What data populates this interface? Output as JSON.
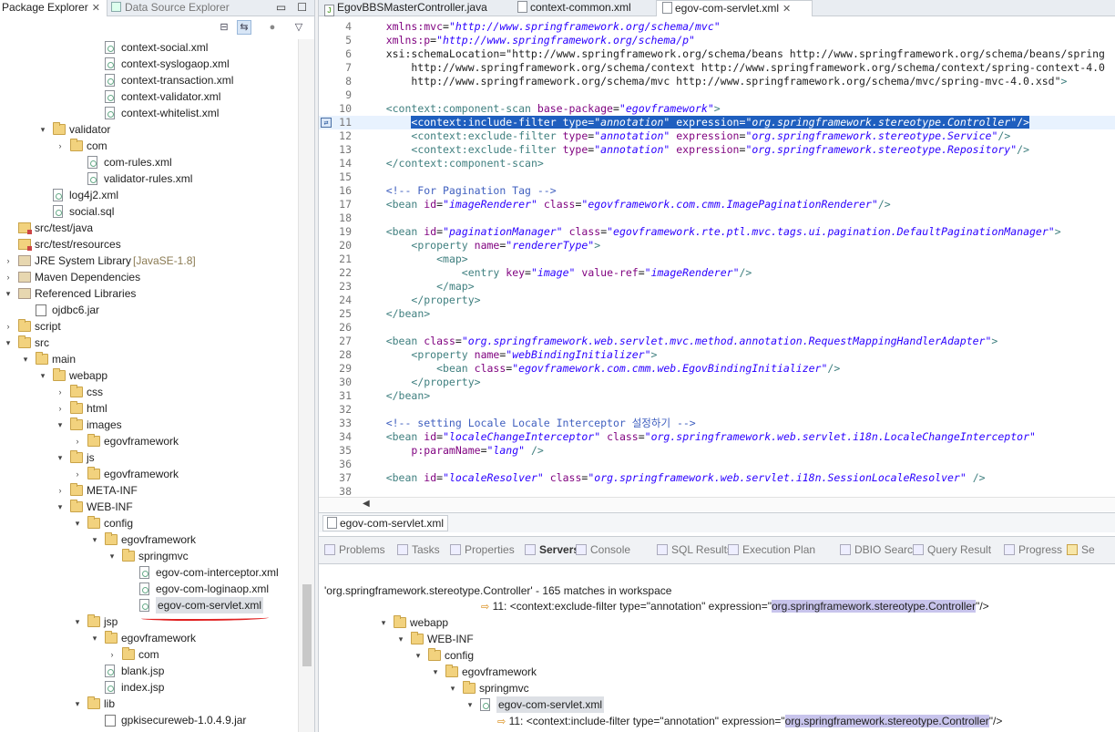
{
  "left_panel": {
    "tabs": [
      "Package Explorer",
      "Data Source Explorer"
    ],
    "window_buttons": [
      "▭",
      "☐"
    ],
    "toolbar_icons": [
      "collapse-all-icon",
      "link-with-editor-icon",
      "view-menu-icon",
      "dropdown-icon"
    ],
    "tree": [
      {
        "label": "context-social.xml",
        "icon": "xml-file-icon"
      },
      {
        "label": "context-syslogaop.xml",
        "icon": "xml-file-icon"
      },
      {
        "label": "context-transaction.xml",
        "icon": "xml-file-icon"
      },
      {
        "label": "context-validator.xml",
        "icon": "xml-file-icon"
      },
      {
        "label": "context-whitelist.xml",
        "icon": "xml-file-icon"
      },
      {
        "label": "validator",
        "icon": "folder-icon"
      },
      {
        "label": "com",
        "icon": "folder-icon"
      },
      {
        "label": "com-rules.xml",
        "icon": "xml-file-icon"
      },
      {
        "label": "validator-rules.xml",
        "icon": "xml-file-icon"
      },
      {
        "label": "log4j2.xml",
        "icon": "xml-file-icon"
      },
      {
        "label": "social.sql",
        "icon": "sql-file-icon"
      },
      {
        "label": "src/test/java",
        "icon": "source-folder-icon"
      },
      {
        "label": "src/test/resources",
        "icon": "source-folder-icon"
      },
      {
        "label": "JRE System Library",
        "suffix": "[JavaSE-1.8]",
        "icon": "library-icon"
      },
      {
        "label": "Maven Dependencies",
        "icon": "library-icon"
      },
      {
        "label": "Referenced Libraries",
        "icon": "library-icon"
      },
      {
        "label": "ojdbc6.jar",
        "icon": "jar-icon"
      },
      {
        "label": "script",
        "icon": "folder-icon"
      },
      {
        "label": "src",
        "icon": "folder-icon"
      },
      {
        "label": "main",
        "icon": "folder-icon"
      },
      {
        "label": "webapp",
        "icon": "folder-icon"
      },
      {
        "label": "css",
        "icon": "folder-icon"
      },
      {
        "label": "html",
        "icon": "folder-icon"
      },
      {
        "label": "images",
        "icon": "folder-icon"
      },
      {
        "label": "egovframework",
        "icon": "folder-icon"
      },
      {
        "label": "js",
        "icon": "folder-icon"
      },
      {
        "label": "egovframework",
        "icon": "folder-icon"
      },
      {
        "label": "META-INF",
        "icon": "folder-icon"
      },
      {
        "label": "WEB-INF",
        "icon": "folder-icon"
      },
      {
        "label": "config",
        "icon": "folder-icon"
      },
      {
        "label": "egovframework",
        "icon": "folder-icon"
      },
      {
        "label": "springmvc",
        "icon": "folder-icon"
      },
      {
        "label": "egov-com-interceptor.xml",
        "icon": "xml-file-icon"
      },
      {
        "label": "egov-com-loginaop.xml",
        "icon": "xml-file-icon"
      },
      {
        "label": "egov-com-servlet.xml",
        "icon": "xml-file-icon",
        "selected": true
      },
      {
        "label": "jsp",
        "icon": "folder-icon"
      },
      {
        "label": "egovframework",
        "icon": "folder-icon"
      },
      {
        "label": "com",
        "icon": "folder-icon"
      },
      {
        "label": "blank.jsp",
        "icon": "jsp-file-icon"
      },
      {
        "label": "index.jsp",
        "icon": "jsp-file-icon"
      },
      {
        "label": "lib",
        "icon": "folder-icon"
      },
      {
        "label": "gpkisecureweb-1.0.4.9.jar",
        "icon": "jar-icon"
      }
    ]
  },
  "editor": {
    "tabs": [
      "EgovBBSMasterController.java",
      "context-common.xml",
      "egov-com-servlet.xml"
    ],
    "active_tab": "egov-com-servlet.xml",
    "bottom_tab": "egov-com-servlet.xml",
    "lines": [
      {
        "n": "4",
        "t": "    xmlns:mvc=\"http://www.springframework.org/schema/mvc\""
      },
      {
        "n": "5",
        "t": "    xmlns:p=\"http://www.springframework.org/schema/p\""
      },
      {
        "n": "6",
        "t": "    xsi:schemaLocation=\"http://www.springframework.org/schema/beans http://www.springframework.org/schema/beans/spring"
      },
      {
        "n": "7",
        "t": "        http://www.springframework.org/schema/context http://www.springframework.org/schema/context/spring-context-4.0"
      },
      {
        "n": "8",
        "t": "        http://www.springframework.org/schema/mvc http://www.springframework.org/schema/mvc/spring-mvc-4.0.xsd\">"
      },
      {
        "n": "9",
        "t": ""
      },
      {
        "n": "10",
        "t": "    <context:component-scan base-package=\"egovframework\">"
      },
      {
        "n": "11",
        "t": "        <context:include-filter type=\"annotation\" expression=\"org.springframework.stereotype.Controller\"/>"
      },
      {
        "n": "12",
        "t": "        <context:exclude-filter type=\"annotation\" expression=\"org.springframework.stereotype.Service\"/>"
      },
      {
        "n": "13",
        "t": "        <context:exclude-filter type=\"annotation\" expression=\"org.springframework.stereotype.Repository\"/>"
      },
      {
        "n": "14",
        "t": "    </context:component-scan>"
      },
      {
        "n": "15",
        "t": ""
      },
      {
        "n": "16",
        "t": "    <!-- For Pagination Tag -->"
      },
      {
        "n": "17",
        "t": "    <bean id=\"imageRenderer\" class=\"egovframework.com.cmm.ImagePaginationRenderer\"/>"
      },
      {
        "n": "18",
        "t": ""
      },
      {
        "n": "19",
        "t": "    <bean id=\"paginationManager\" class=\"egovframework.rte.ptl.mvc.tags.ui.pagination.DefaultPaginationManager\">"
      },
      {
        "n": "20",
        "t": "        <property name=\"rendererType\">"
      },
      {
        "n": "21",
        "t": "            <map>"
      },
      {
        "n": "22",
        "t": "                <entry key=\"image\" value-ref=\"imageRenderer\"/>"
      },
      {
        "n": "23",
        "t": "            </map>"
      },
      {
        "n": "24",
        "t": "        </property>"
      },
      {
        "n": "25",
        "t": "    </bean>"
      },
      {
        "n": "26",
        "t": ""
      },
      {
        "n": "27",
        "t": "    <bean class=\"org.springframework.web.servlet.mvc.method.annotation.RequestMappingHandlerAdapter\">"
      },
      {
        "n": "28",
        "t": "        <property name=\"webBindingInitializer\">"
      },
      {
        "n": "29",
        "t": "            <bean class=\"egovframework.com.cmm.web.EgovBindingInitializer\"/>"
      },
      {
        "n": "30",
        "t": "        </property>"
      },
      {
        "n": "31",
        "t": "    </bean>"
      },
      {
        "n": "32",
        "t": ""
      },
      {
        "n": "33",
        "t": "    <!-- setting Locale Locale Interceptor 설정하기 -->"
      },
      {
        "n": "34",
        "t": "    <bean id=\"localeChangeInterceptor\" class=\"org.springframework.web.servlet.i18n.LocaleChangeInterceptor\""
      },
      {
        "n": "35",
        "t": "        p:paramName=\"lang\" />"
      },
      {
        "n": "36",
        "t": ""
      },
      {
        "n": "37",
        "t": "    <bean id=\"localeResolver\" class=\"org.springframework.web.servlet.i18n.SessionLocaleResolver\" />"
      },
      {
        "n": "38",
        "t": ""
      }
    ],
    "highlight_line": "11"
  },
  "bottom_panel": {
    "tabs": [
      "Problems",
      "Tasks",
      "Properties",
      "Servers",
      "Console",
      "SQL Results",
      "Execution Plan",
      "DBIO Search",
      "Query Result",
      "Progress",
      "Se"
    ],
    "search_summary": "'org.springframework.stereotype.Controller' - 165 matches in workspace",
    "match_prefix": "11: <context:exclude-filter type=\"annotation\" expression=\"",
    "match_text": "org.springframework.stereotype.Controller",
    "match_suffix": "\"/>",
    "match2_prefix": "11: <context:include-filter type=\"annotation\" expression=\"",
    "tree": [
      "webapp",
      "WEB-INF",
      "config",
      "egovframework",
      "springmvc",
      "egov-com-servlet.xml"
    ]
  }
}
